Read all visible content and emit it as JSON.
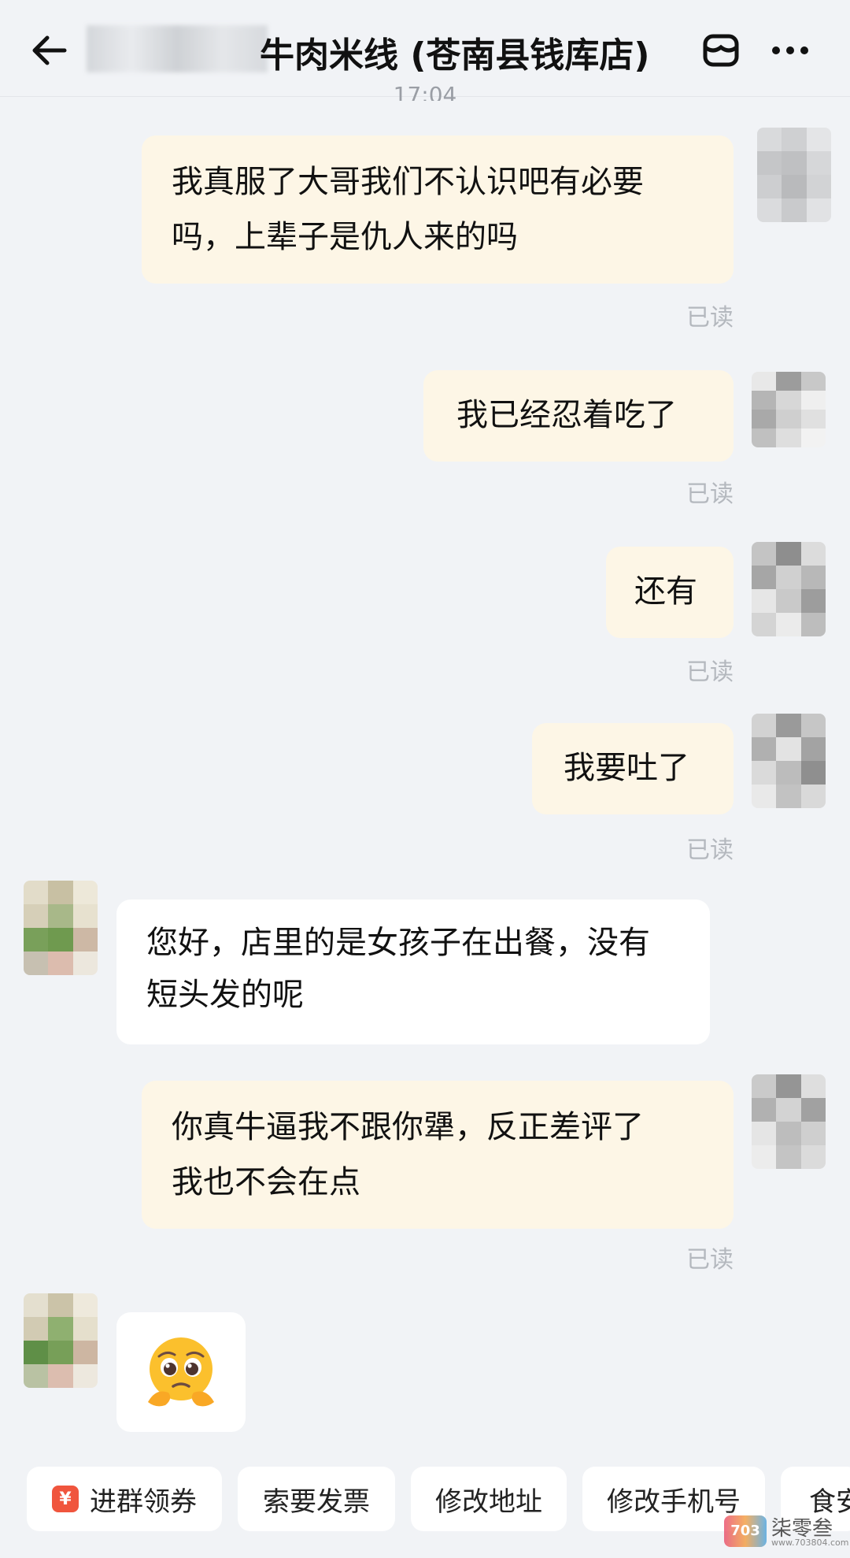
{
  "header": {
    "title": "牛肉米线 (苍南县钱库店)",
    "back_icon": "back-arrow-icon",
    "store_icon": "store-icon",
    "more_icon": "more-dots-icon"
  },
  "time_label": "17:04",
  "messages": [
    {
      "side": "out",
      "line1": "我真服了大哥我们不认识吧有必要",
      "line2": "吗，上辈子是仇人来的吗",
      "status": "已读"
    },
    {
      "side": "out",
      "line1": "我已经忍着吃了",
      "status": "已读"
    },
    {
      "side": "out",
      "line1": "还有",
      "status": "已读"
    },
    {
      "side": "out",
      "line1": "我要吐了",
      "status": "已读"
    },
    {
      "side": "in",
      "line1": "您好，店里的是女孩子在出餐，没有",
      "line2": "短头发的呢"
    },
    {
      "side": "out",
      "line1": "你真牛逼我不跟你犟，反正差评了",
      "line2": "我也不会在点",
      "status": "已读"
    },
    {
      "side": "in",
      "emoji": "pleading-face-emoji"
    }
  ],
  "quick_actions": [
    {
      "label": "进群领券",
      "icon": "coupon-icon",
      "icon_text": "¥"
    },
    {
      "label": "索要发票"
    },
    {
      "label": "修改地址"
    },
    {
      "label": "修改手机号"
    },
    {
      "label": "食安"
    }
  ],
  "watermark": {
    "text": "柒零叁",
    "url": "www.703804.com",
    "logo": "703"
  },
  "colors": {
    "bg": "#f1f3f6",
    "outgoing": "#fdf6e6",
    "incoming": "#ffffff",
    "read": "#b4b8be",
    "accent": "#f0553d"
  }
}
